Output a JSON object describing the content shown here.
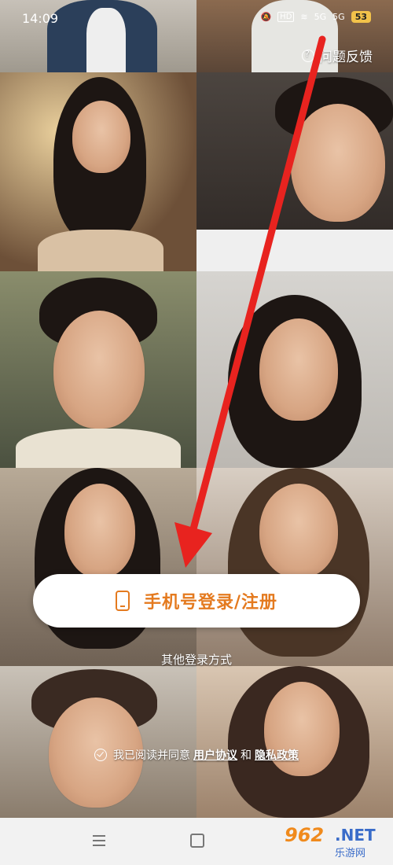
{
  "statusbar": {
    "time": "14:09",
    "hd_label": "HD",
    "net1": "5G",
    "net2": "5G",
    "battery": "53"
  },
  "feedback": {
    "label": "问题反馈",
    "icon": "help-circle-icon"
  },
  "login": {
    "label": "手机号登录/注册",
    "icon": "phone-icon",
    "accent": "#e47a1f"
  },
  "other_login": {
    "label": "其他登录方式"
  },
  "agreement": {
    "prefix": "我已阅读并同意",
    "user_agreement": "用户协议",
    "and": "和",
    "privacy_policy": "隐私政策"
  },
  "annotation": {
    "color": "#e8231f"
  },
  "watermark": {
    "number": "962",
    "suffix": ".NET",
    "site": "乐游网"
  }
}
